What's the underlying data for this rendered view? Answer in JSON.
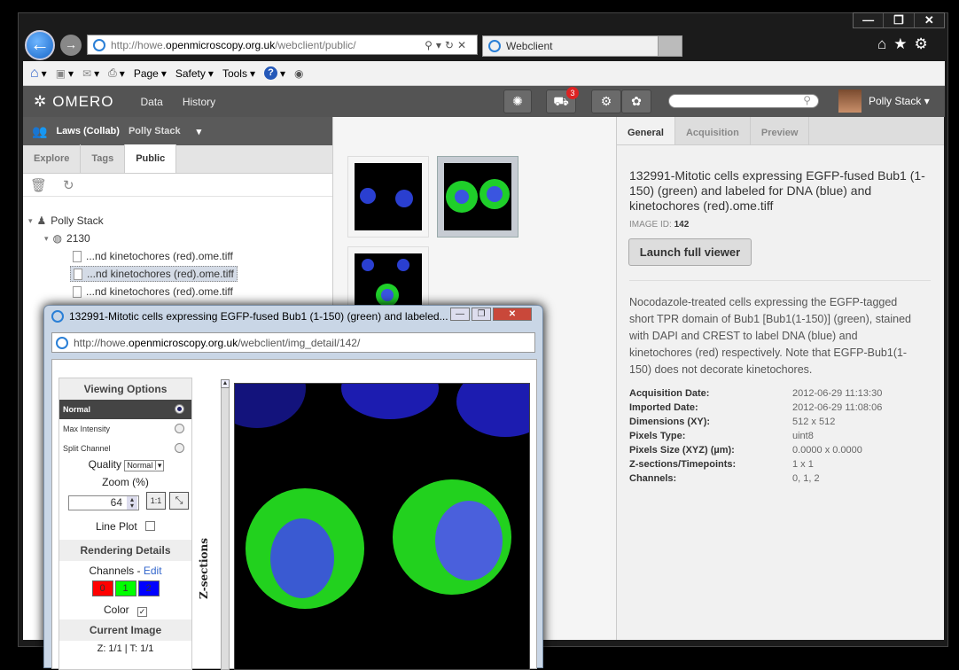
{
  "browser": {
    "url_prefix": "http://howe.",
    "url_domain": "openmicroscopy.org.uk",
    "url_path": "/webclient/public/",
    "tab_title": "Webclient",
    "window_controls": [
      "—",
      "❐",
      "✕"
    ],
    "command_bar": {
      "page": "Page",
      "safety": "Safety",
      "tools": "Tools"
    }
  },
  "omero": {
    "logo": "OMERO",
    "nav": {
      "data": "Data",
      "history": "History"
    },
    "basket_count": "3",
    "user": "Polly Stack"
  },
  "left": {
    "group": "Laws (Collab)",
    "group_user": "Polly Stack",
    "tabs": [
      "Explore",
      "Tags",
      "Public"
    ],
    "tree": {
      "user": "Polly Stack",
      "dataset": "2130",
      "files": [
        "...nd kinetochores (red).ome.tiff",
        "...nd kinetochores (red).ome.tiff",
        "...nd kinetochores (red).ome.tiff"
      ]
    }
  },
  "right": {
    "tabs": [
      "General",
      "Acquisition",
      "Preview"
    ],
    "image_name": "132991-Mitotic cells expressing EGFP-fused Bub1 (1-150) (green) and labeled for DNA (blue) and kinetochores (red).ome.tiff",
    "image_id_label": "IMAGE ID:",
    "image_id": "142",
    "launch_label": "Launch full viewer",
    "description": "Nocodazole-treated cells expressing the EGFP-tagged short TPR domain of Bub1 [Bub1(1-150)] (green), stained with DAPI and CREST to label DNA (blue) and kinetochores (red) respectively. Note that EGFP-Bub1(1-150) does not decorate kinetochores.",
    "metadata": [
      {
        "k": "Acquisition Date:",
        "v": "2012-06-29 11:13:30"
      },
      {
        "k": "Imported Date:",
        "v": "2012-06-29 11:08:06"
      },
      {
        "k": "Dimensions (XY):",
        "v": "512 x 512"
      },
      {
        "k": "Pixels Type:",
        "v": "uint8"
      },
      {
        "k": "Pixels Size (XYZ) (µm):",
        "v": "0.0000 x 0.0000"
      },
      {
        "k": "Z-sections/Timepoints:",
        "v": "1 x 1"
      },
      {
        "k": "Channels:",
        "v": "0, 1, 2"
      }
    ]
  },
  "popup": {
    "title": "132991-Mitotic cells expressing EGFP-fused Bub1 (1-150) (green) and labeled...",
    "url_prefix": "http://howe.",
    "url_domain": "openmicroscopy.org.uk",
    "url_path": "/webclient/img_detail/142/",
    "viewing_options": "Viewing Options",
    "modes": [
      "Normal",
      "Max Intensity",
      "Split Channel"
    ],
    "quality_label": "Quality",
    "quality_value": "Normal",
    "zoom_label": "Zoom (%)",
    "zoom_value": "64",
    "zoom_1to1": "1:1",
    "line_plot": "Line Plot",
    "rendering_details": "Rendering Details",
    "channels_label": "Channels - ",
    "channels_edit": "Edit",
    "channels": [
      "0",
      "1",
      "2"
    ],
    "color_label": "Color",
    "current_image": "Current Image",
    "zt": "Z: 1/1 | T: 1/1",
    "zsections": "Z-sections"
  },
  "colors": {
    "channel0": "#ff0000",
    "channel1": "#00ff00",
    "channel2": "#0000ff",
    "omero_header": "#545454"
  }
}
